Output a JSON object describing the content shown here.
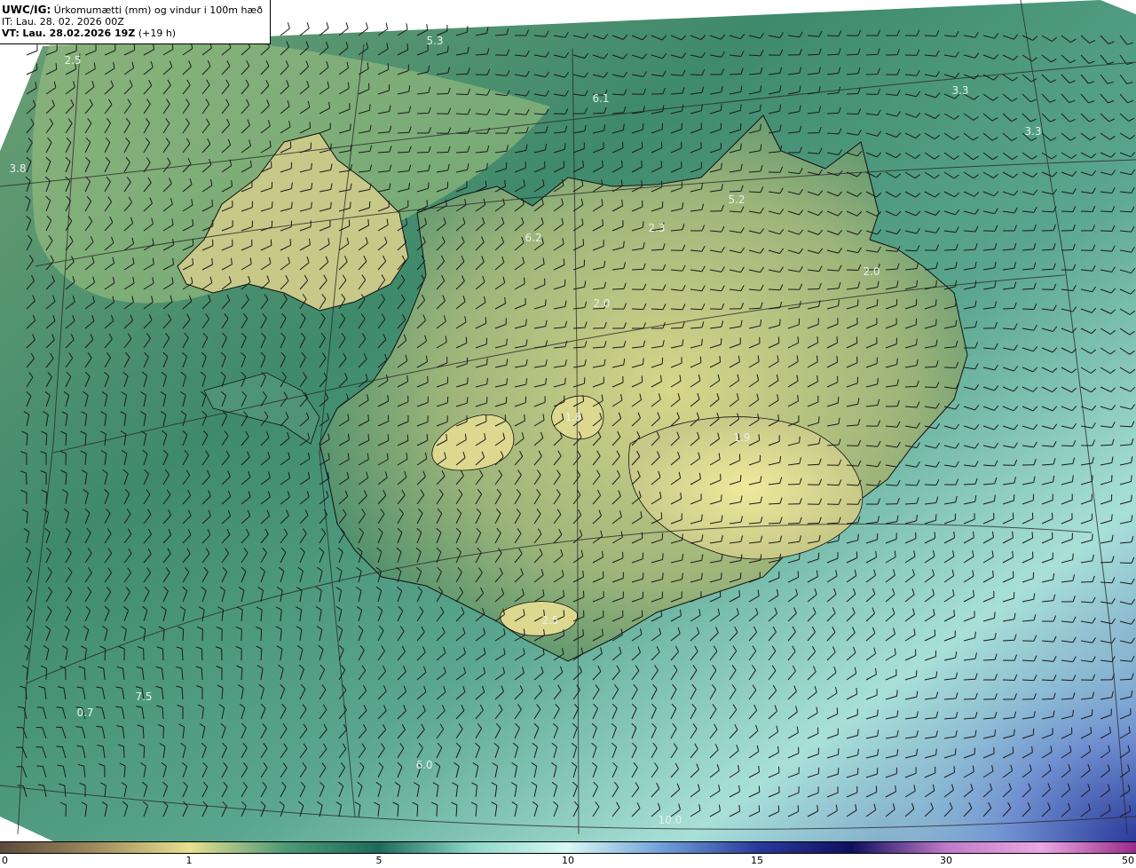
{
  "header": {
    "model": "UWC/IG:",
    "field": "Úrkomumætti (mm) og vindur i 100m hæð",
    "init_line": "IT: Lau. 28. 02. 2026 00Z",
    "valid_prefix": "VT:",
    "valid_time": "Lau. 28.02.2026 19Z",
    "lead": "(+19 h)"
  },
  "colorbar": {
    "ticks": [
      "0",
      "1",
      "5",
      "10",
      "15",
      "30",
      "50"
    ],
    "stops": [
      "#5b4a3a",
      "#a08a5f",
      "#e8e08f",
      "#4f9a78",
      "#1f6a5a",
      "#8fd8c8",
      "#d8f8f4",
      "#6f9fd8",
      "#2a3a9a",
      "#101060",
      "#c07ac8",
      "#e8a8e0",
      "#9a2a8a"
    ]
  },
  "map": {
    "labels": [
      {
        "text": "5.3"
      },
      {
        "text": "6.1"
      },
      {
        "text": "3.3"
      },
      {
        "text": "3.3"
      },
      {
        "text": "3.8"
      },
      {
        "text": "2.5"
      },
      {
        "text": "5.2"
      },
      {
        "text": "6.2"
      },
      {
        "text": "2.3"
      },
      {
        "text": "2.0"
      },
      {
        "text": "2.0"
      },
      {
        "text": "1.8"
      },
      {
        "text": "1.9"
      },
      {
        "text": "2.5"
      },
      {
        "text": "0.7"
      },
      {
        "text": "7.5"
      },
      {
        "text": "6.0"
      },
      {
        "text": "10.0"
      }
    ]
  }
}
